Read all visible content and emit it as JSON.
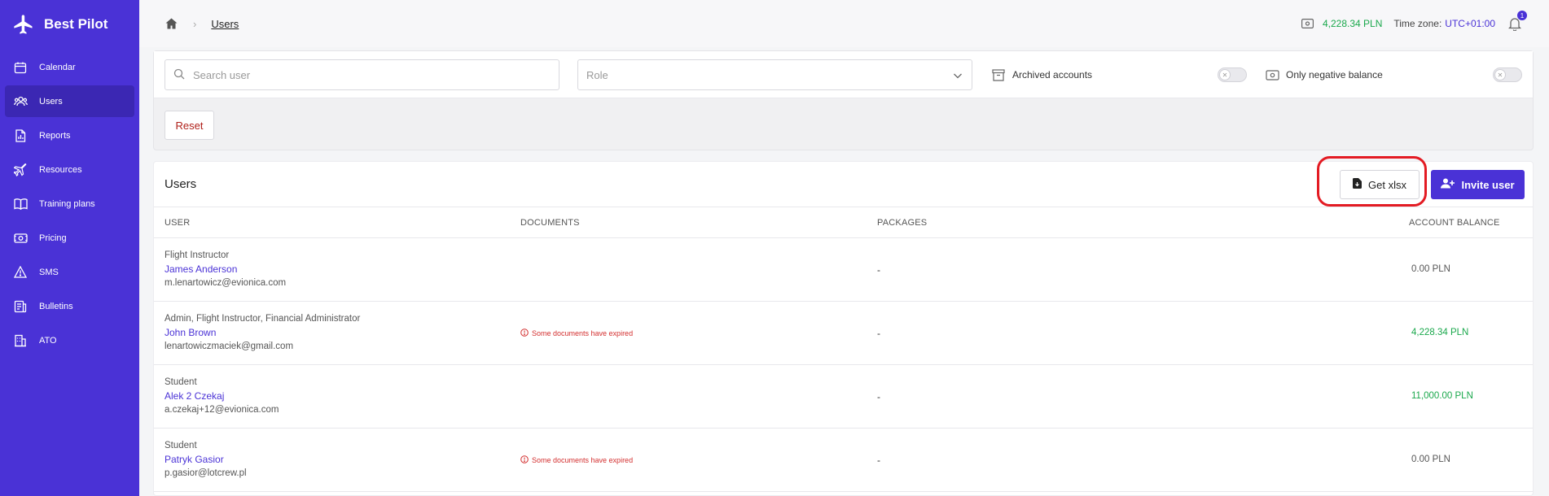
{
  "app": {
    "brand": "Best Pilot"
  },
  "sidebar": {
    "items": [
      {
        "label": "Calendar",
        "icon": "calendar-icon",
        "active": false
      },
      {
        "label": "Users",
        "icon": "users-icon",
        "active": true
      },
      {
        "label": "Reports",
        "icon": "report-icon",
        "active": false
      },
      {
        "label": "Resources",
        "icon": "plane-icon",
        "active": false
      },
      {
        "label": "Training plans",
        "icon": "book-icon",
        "active": false
      },
      {
        "label": "Pricing",
        "icon": "money-icon",
        "active": false
      },
      {
        "label": "SMS",
        "icon": "warning-icon",
        "active": false
      },
      {
        "label": "Bulletins",
        "icon": "bulletin-icon",
        "active": false
      },
      {
        "label": "ATO",
        "icon": "building-icon",
        "active": false
      }
    ]
  },
  "topbar": {
    "breadcrumb_current": "Users",
    "balance": "4,228.34 PLN",
    "timezone_label": "Time zone:",
    "timezone_value": "UTC+01:00",
    "notification_count": "1"
  },
  "filters": {
    "search_placeholder": "Search user",
    "role_placeholder": "Role",
    "archived_label": "Archived accounts",
    "negative_label": "Only negative balance",
    "reset_label": "Reset"
  },
  "users_card": {
    "title": "Users",
    "get_xlsx_label": "Get xlsx",
    "invite_label": "Invite user",
    "columns": [
      "USER",
      "DOCUMENTS",
      "PACKAGES",
      "ACCOUNT BALANCE"
    ],
    "rows": [
      {
        "role": "Flight Instructor",
        "name": "James Anderson",
        "email": "m.lenartowicz@evionica.com",
        "documents": "",
        "packages": "-",
        "balance": "0.00 PLN",
        "balance_color": "#555555"
      },
      {
        "role": "Admin, Flight Instructor, Financial Administrator",
        "name": "John Brown",
        "email": "lenartowiczmaciek@gmail.com",
        "documents": "Some documents have expired",
        "packages": "-",
        "balance": "4,228.34 PLN",
        "balance_color": "#1aa84c"
      },
      {
        "role": "Student",
        "name": "Alek 2 Czekaj",
        "email": "a.czekaj+12@evionica.com",
        "documents": "",
        "packages": "-",
        "balance": "11,000.00 PLN",
        "balance_color": "#1aa84c"
      },
      {
        "role": "Student",
        "name": "Patryk Gasior",
        "email": "p.gasior@lotcrew.pl",
        "documents": "Some documents have expired",
        "packages": "-",
        "balance": "0.00 PLN",
        "balance_color": "#555555"
      }
    ]
  },
  "colors": {
    "brand": "#4a32d6",
    "positive": "#1aa84c",
    "danger": "#d32f2f",
    "highlight": "#e31b23"
  }
}
